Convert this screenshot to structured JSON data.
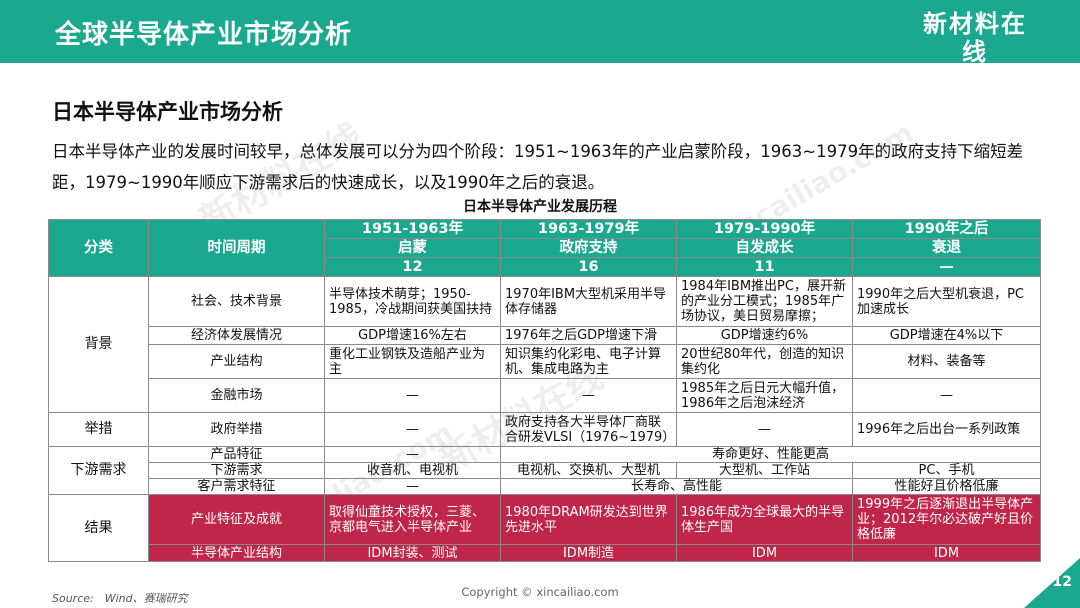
{
  "header": {
    "title": "全球半导体产业市场分析",
    "logo_cn": "新材料在线",
    "logo_en": "xincailiao.com"
  },
  "section_title": "日本半导体产业市场分析",
  "intro": "日本半导体产业的发展时间较早，总体发展可以分为四个阶段：1951~1963年的产业启蒙阶段，1963~1979年的政府支持下缩短差距，1979~1990年顺应下游需求后的快速成长，以及1990年之后的衰退。",
  "table_caption": "日本半导体产业发展历程",
  "table": {
    "head": {
      "category": "分类",
      "period": "时间周期",
      "stages": [
        {
          "years": "1951-1963年",
          "name": "启蒙",
          "duration": "12"
        },
        {
          "years": "1963-1979年",
          "name": "政府支持",
          "duration": "16"
        },
        {
          "years": "1979-1990年",
          "name": "自发成长",
          "duration": "11"
        },
        {
          "years": "1990年之后",
          "name": "衰退",
          "duration": "—"
        }
      ]
    },
    "categories": {
      "background": "背景",
      "measures": "举措",
      "demand": "下游需求",
      "result": "结果"
    },
    "rows": {
      "social": {
        "label": "社会、技术背景",
        "cells": [
          "半导体技术萌芽；1950-1985，冷战期间获美国扶持",
          "1970年IBM大型机采用半导体存储器",
          "1984年IBM推出PC，展开新的产业分工模式；1985年广场协议，美日贸易摩擦；",
          "1990年之后大型机衰退，PC加速成长"
        ]
      },
      "economy": {
        "label": "经济体发展情况",
        "cells": [
          "GDP增速16%左右",
          "1976年之后GDP增速下滑",
          "GDP增速约6%",
          "GDP增速在4%以下"
        ]
      },
      "industry": {
        "label": "产业结构",
        "cells": [
          "重化工业钢铁及造船产业为主",
          "知识集约化彩电、电子计算机、集成电路为主",
          "20世纪80年代，创造的知识集约化",
          "材料、装备等"
        ]
      },
      "finance": {
        "label": "金融市场",
        "cells": [
          "—",
          "—",
          "1985年之后日元大幅升值，1986年之后泡沫经济",
          "—"
        ]
      },
      "gov": {
        "label": "政府举措",
        "cells": [
          "—",
          "政府支持各大半导体厂商联合研发VLSI（1976~1979）",
          "—",
          "1996年之后出台一系列政策"
        ]
      },
      "product": {
        "label": "产品特征",
        "cells": [
          "—",
          "寿命更好、性能更高"
        ]
      },
      "downstream": {
        "label": "下游需求",
        "cells": [
          "收音机、电视机",
          "电视机、交换机、大型机",
          "大型机、工作站",
          "PC、手机"
        ]
      },
      "customer": {
        "label": "客户需求特征",
        "cells": [
          "—",
          "长寿命、高性能",
          "性能好且价格低廉"
        ]
      },
      "achievement": {
        "label": "产业特征及成就",
        "cells": [
          "取得仙童技术授权，三菱、京都电气进入半导体产业",
          "1980年DRAM研发达到世界先进水平",
          "1986年成为全球最大的半导体生产国",
          "1999年之后逐渐退出半导体产业；2012年尔必达破产好且价格低廉"
        ]
      },
      "structure": {
        "label": "半导体产业结构",
        "cells": [
          "IDM封装、测试",
          "IDM制造",
          "IDM",
          "IDM"
        ]
      }
    }
  },
  "watermark": "新材料在线",
  "watermark_en": "xincailiao.com",
  "source": "Source:　Wind、赛瑞研究",
  "copyright": "Copyright © xincailiao.com",
  "page_number": "12",
  "colors": {
    "accent": "#1aa88f",
    "highlight": "#c0264a"
  }
}
